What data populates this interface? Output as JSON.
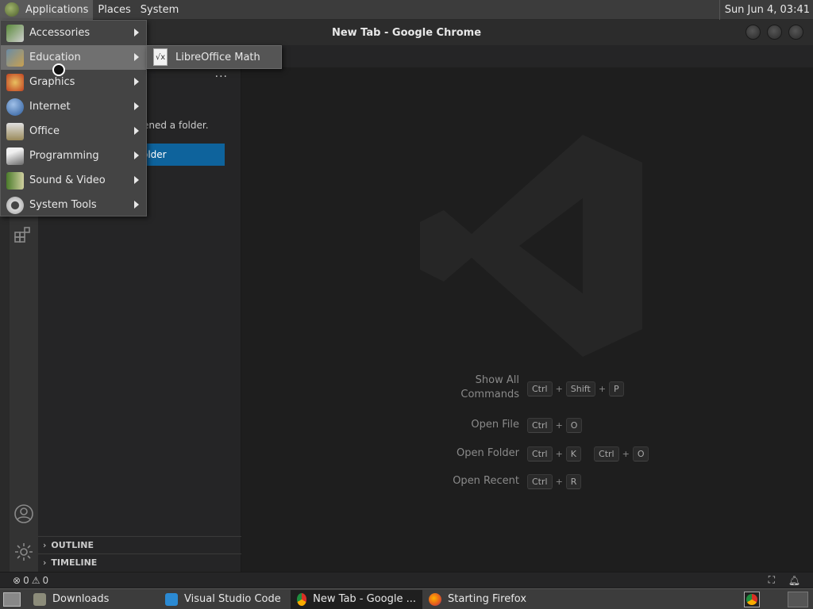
{
  "top_panel": {
    "menus": [
      "Applications",
      "Places",
      "System"
    ],
    "clock": "Sun Jun  4, 03:41"
  },
  "window": {
    "title": "New Tab - Google Chrome"
  },
  "apps_menu": {
    "items": [
      {
        "label": "Accessories",
        "icon": "accessories-icon"
      },
      {
        "label": "Education",
        "icon": "education-icon"
      },
      {
        "label": "Graphics",
        "icon": "graphics-icon"
      },
      {
        "label": "Internet",
        "icon": "internet-icon"
      },
      {
        "label": "Office",
        "icon": "office-icon"
      },
      {
        "label": "Programming",
        "icon": "programming-icon"
      },
      {
        "label": "Sound & Video",
        "icon": "sound-video-icon"
      },
      {
        "label": "System Tools",
        "icon": "system-tools-icon"
      }
    ],
    "highlighted": "Education",
    "submenu": {
      "label": "LibreOffice Math",
      "icon": "libreoffice-math-icon"
    }
  },
  "sidebar": {
    "message_partial": "ened a folder.",
    "open_button_partial": "older",
    "sections": [
      "OUTLINE",
      "TIMELINE"
    ]
  },
  "shortcuts": [
    {
      "label": "Show All Commands",
      "keys": [
        [
          "Ctrl",
          "Shift",
          "P"
        ]
      ]
    },
    {
      "label": "Open File",
      "keys": [
        [
          "Ctrl",
          "O"
        ]
      ]
    },
    {
      "label": "Open Folder",
      "keys": [
        [
          "Ctrl",
          "K"
        ],
        [
          "Ctrl",
          "O"
        ]
      ]
    },
    {
      "label": "Open Recent",
      "keys": [
        [
          "Ctrl",
          "R"
        ]
      ]
    }
  ],
  "status": {
    "errors": "0",
    "warnings": "0"
  },
  "taskbar": {
    "items": [
      {
        "label": "Downloads",
        "icon": "folder-icon"
      },
      {
        "label": "Visual Studio Code",
        "icon": "vscode-icon"
      },
      {
        "label": "New Tab - Google ...",
        "icon": "chrome-icon",
        "active": true
      },
      {
        "label": "Starting Firefox",
        "icon": "firefox-icon"
      }
    ]
  }
}
